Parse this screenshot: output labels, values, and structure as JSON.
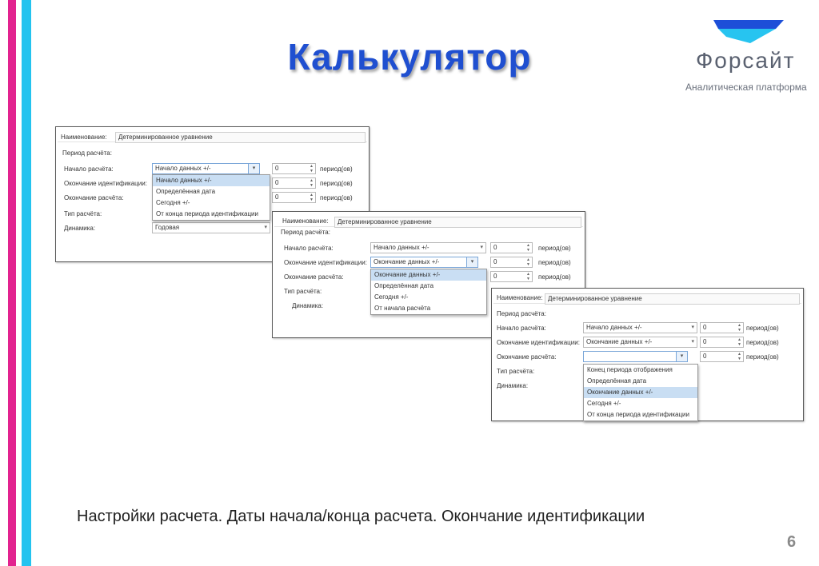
{
  "slide": {
    "title": "Калькулятор",
    "caption": "Настройки расчета. Даты начала/конца расчета. Окончание идентификации",
    "page_number": "6"
  },
  "logo": {
    "name": "Форсайт",
    "subtitle": "Аналитическая платформа",
    "colors": {
      "top": "#1d4fd8",
      "bottom": "#27c4f0"
    }
  },
  "colors": {
    "magenta": "#e2238f",
    "cyan": "#23c3ef",
    "title": "#1f4fd0",
    "highlight": "#c9def3"
  },
  "panel1": {
    "name_label": "Наименование:",
    "name_value": "Детерминированное уравнение",
    "period_label": "Период расчёта:",
    "start_label": "Начало расчёта:",
    "start_value": "Начало данных +/-",
    "start_offset": "0",
    "start_unit": "период(ов)",
    "ident_label": "Окончание идентификации:",
    "ident_offset": "0",
    "ident_unit": "период(ов)",
    "end_label": "Окончание расчёта:",
    "end_offset": "0",
    "end_unit": "период(ов)",
    "type_label": "Тип расчёта:",
    "dynamics_label": "Динамика:",
    "dynamics_value": "Годовая",
    "dropdown": [
      "Начало данных +/-",
      "Определённая дата",
      "Сегодня +/-",
      "От конца периода идентификации"
    ]
  },
  "panel2": {
    "name_label": "Наименование:",
    "name_value": "Детерминированное уравнение",
    "period_label": "Период расчёта:",
    "start_label": "Начало расчёта:",
    "start_value": "Начало данных +/-",
    "start_offset": "0",
    "start_unit": "период(ов)",
    "ident_label": "Окончание идентификации:",
    "ident_value": "Окончание данных +/-",
    "ident_offset": "0",
    "ident_unit": "период(ов)",
    "end_label": "Окончание расчёта:",
    "end_offset": "0",
    "end_unit": "период(ов)",
    "type_label": "Тип расчёта:",
    "dynamics_label": "Динамика:",
    "dropdown": [
      "Окончание данных +/-",
      "Определённая дата",
      "Сегодня +/-",
      "От начала расчёта"
    ]
  },
  "panel3": {
    "name_label": "Наименование:",
    "name_value": "Детерминированное уравнение",
    "period_label": "Период расчёта:",
    "start_label": "Начало расчёта:",
    "start_value": "Начало данных +/-",
    "start_offset": "0",
    "start_unit": "период(ов)",
    "ident_label": "Окончание идентификации:",
    "ident_value": "Окончание данных +/-",
    "ident_offset": "0",
    "ident_unit": "период(ов)",
    "end_label": "Окончание расчёта:",
    "end_offset": "0",
    "end_unit": "период(ов)",
    "type_label": "Тип расчёта:",
    "dynamics_label": "Динамика:",
    "dropdown": [
      "Конец периода отображения",
      "Определённая дата",
      "Окончание данных +/-",
      "Сегодня +/-",
      "От конца периода идентификации"
    ]
  }
}
